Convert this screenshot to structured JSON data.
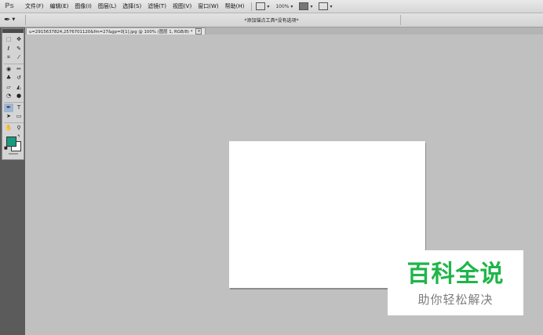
{
  "app": {
    "logo": "Ps"
  },
  "menu": {
    "items": [
      "文件(F)",
      "编辑(E)",
      "图像(I)",
      "图层(L)",
      "选择(S)",
      "滤镜(T)",
      "视图(V)",
      "窗口(W)",
      "帮助(H)"
    ],
    "zoom": "100%"
  },
  "options_bar": {
    "hint": "*添加锚点工具*没有选项*"
  },
  "document": {
    "tab_title": "u=2915637824,2576701120&fm=27&gp=0[1].jpg @ 100% (图层 1, RGB/8) *",
    "close_glyph": "×"
  },
  "toolbox": {
    "foreground_color": "#1a9a7e",
    "background_color": "#ffffff",
    "tools": [
      {
        "name": "marquee-tool-icon",
        "glyph": "⬚"
      },
      {
        "name": "move-tool-icon",
        "glyph": "✥"
      },
      {
        "name": "lasso-tool-icon",
        "glyph": "ℓ"
      },
      {
        "name": "quick-selection-tool-icon",
        "glyph": "✎"
      },
      {
        "name": "crop-tool-icon",
        "glyph": "⌗"
      },
      {
        "name": "eyedropper-tool-icon",
        "glyph": "⁄"
      },
      {
        "name": "spot-healing-tool-icon",
        "glyph": "◉"
      },
      {
        "name": "brush-tool-icon",
        "glyph": "✏"
      },
      {
        "name": "clone-stamp-tool-icon",
        "glyph": "♣"
      },
      {
        "name": "history-brush-tool-icon",
        "glyph": "↺"
      },
      {
        "name": "eraser-tool-icon",
        "glyph": "▱"
      },
      {
        "name": "gradient-tool-icon",
        "glyph": "◭"
      },
      {
        "name": "blur-tool-icon",
        "glyph": "◔"
      },
      {
        "name": "dodge-tool-icon",
        "glyph": "●"
      },
      {
        "name": "pen-tool-icon",
        "glyph": "✒"
      },
      {
        "name": "type-tool-icon",
        "glyph": "T"
      },
      {
        "name": "path-selection-tool-icon",
        "glyph": "➤"
      },
      {
        "name": "shape-tool-icon",
        "glyph": "▭"
      },
      {
        "name": "hand-tool-icon",
        "glyph": "✋"
      },
      {
        "name": "zoom-tool-icon",
        "glyph": "⚲"
      }
    ]
  },
  "watermark": {
    "main": "百科全说",
    "sub": "助你轻松解决"
  }
}
